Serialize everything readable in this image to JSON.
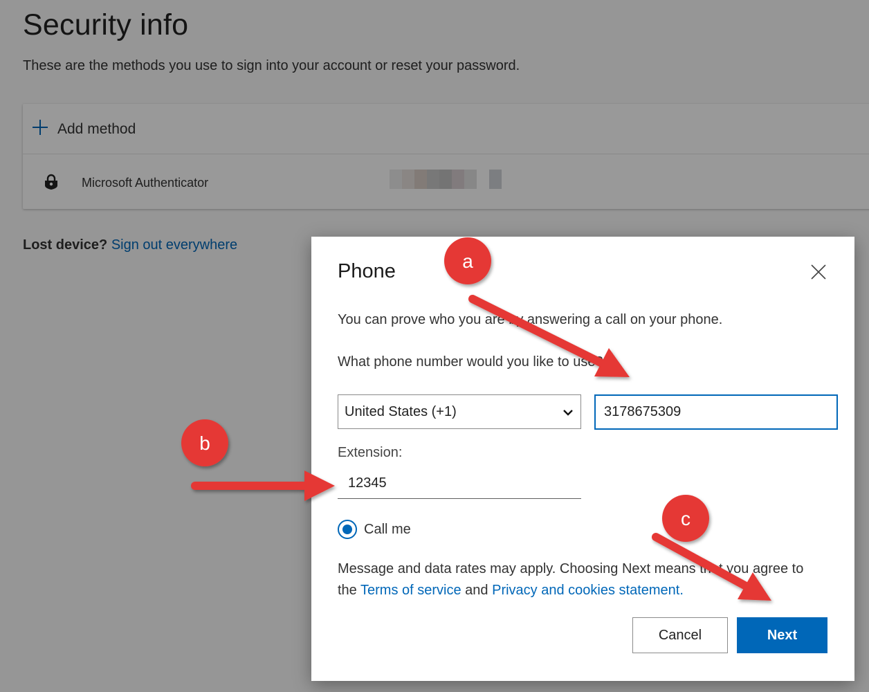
{
  "page": {
    "title": "Security info",
    "subtitle": "These are the methods you use to sign into your account or reset your password.",
    "add_method_label": "Add method",
    "methods": [
      {
        "name": "Microsoft Authenticator",
        "icon": "authenticator-lock-icon"
      }
    ],
    "lost_device_question": "Lost device?",
    "sign_out_link": "Sign out everywhere"
  },
  "dialog": {
    "title": "Phone",
    "description": "You can prove who you are by answering a call on your phone.",
    "question": "What phone number would you like to use?",
    "country_selected": "United States (+1)",
    "phone_value": "3178675309",
    "extension_label": "Extension:",
    "extension_value": "12345",
    "radio_label": "Call me",
    "radio_checked": true,
    "legal_text_1": "Message and data rates may apply. Choosing Next means that you agree to the",
    "terms_link": "Terms of service",
    "legal_and": "and",
    "privacy_link": "Privacy and cookies statement.",
    "cancel_label": "Cancel",
    "next_label": "Next"
  },
  "annotations": [
    {
      "label": "a"
    },
    {
      "label": "b"
    },
    {
      "label": "c"
    }
  ],
  "colors": {
    "accent": "#0067b8",
    "annotation_red": "#e53935",
    "overlay": "rgba(0,0,0,0.4)"
  }
}
